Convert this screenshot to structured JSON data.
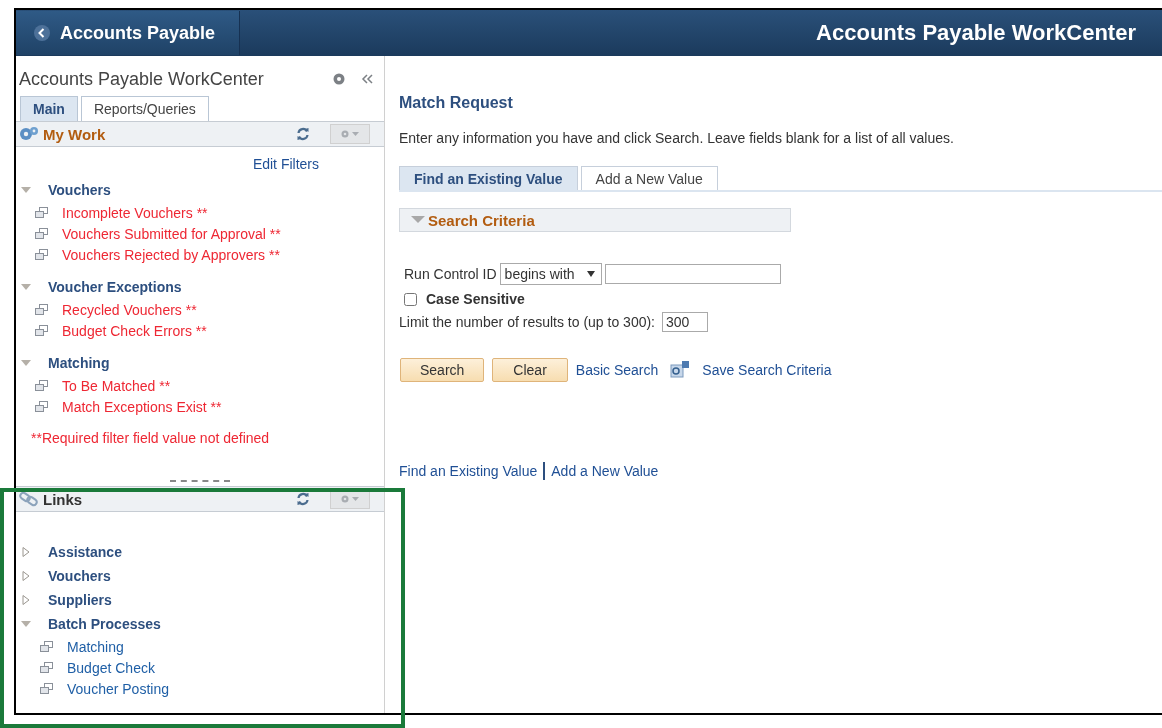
{
  "header": {
    "back_label": "Accounts Payable",
    "title": "Accounts Payable WorkCenter"
  },
  "workcenter": {
    "title": "Accounts Payable WorkCenter",
    "tabs": [
      {
        "label": "Main",
        "selected": true
      },
      {
        "label": "Reports/Queries",
        "selected": false
      }
    ],
    "my_work": {
      "title": "My Work",
      "edit_filters": "Edit Filters",
      "groups": [
        {
          "label": "Vouchers",
          "expanded": true,
          "children": [
            {
              "label": "Incomplete Vouchers **"
            },
            {
              "label": "Vouchers Submitted for Approval **"
            },
            {
              "label": "Vouchers Rejected by Approvers **"
            }
          ]
        },
        {
          "label": "Voucher Exceptions",
          "expanded": true,
          "children": [
            {
              "label": "Recycled Vouchers **"
            },
            {
              "label": "Budget Check Errors **"
            }
          ]
        },
        {
          "label": "Matching",
          "expanded": true,
          "children": [
            {
              "label": "To Be Matched **"
            },
            {
              "label": "Match Exceptions Exist **"
            }
          ]
        }
      ],
      "note": "**Required filter field value not defined"
    },
    "links": {
      "title": "Links",
      "groups": [
        {
          "label": "Assistance",
          "expanded": false
        },
        {
          "label": "Vouchers",
          "expanded": false
        },
        {
          "label": "Suppliers",
          "expanded": false
        },
        {
          "label": "Batch Processes",
          "expanded": true,
          "children": [
            {
              "label": "Matching"
            },
            {
              "label": "Budget Check"
            },
            {
              "label": "Voucher Posting"
            }
          ]
        }
      ]
    }
  },
  "main": {
    "title": "Match Request",
    "instructions": "Enter any information you have and click Search. Leave fields blank for a list of all values.",
    "tabs": [
      {
        "label": "Find an Existing Value",
        "selected": true
      },
      {
        "label": "Add a New Value",
        "selected": false
      }
    ],
    "search_criteria": {
      "label": "Search Criteria",
      "expanded": true
    },
    "run_control": {
      "label": "Run Control ID",
      "operator": "begins with"
    },
    "case_sensitive": {
      "label": "Case Sensitive",
      "checked": false
    },
    "limit": {
      "label": "Limit the number of results to (up to 300):",
      "value": "300"
    },
    "buttons": [
      "Search",
      "Clear"
    ],
    "basic_search": "Basic Search",
    "save_search": "Save Search Criteria",
    "footer_links": [
      "Find an Existing Value",
      "Add a New Value"
    ]
  }
}
